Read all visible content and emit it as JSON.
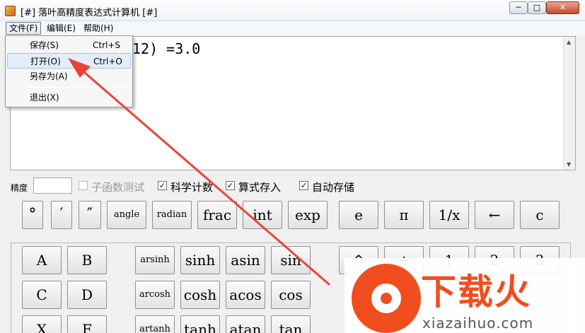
{
  "window": {
    "title": "[#] 落叶高精度表达式计算机 [#]",
    "min_glyph": "─",
    "max_glyph": "□",
    "close_glyph": "✕"
  },
  "menubar": {
    "file": "文件(F)",
    "edit": "编辑(E)",
    "help": "帮助(H)"
  },
  "file_menu": {
    "items": [
      {
        "label": "保存(S)",
        "shortcut": "Ctrl+S"
      },
      {
        "label": "打开(O)",
        "shortcut": "Ctrl+O"
      },
      {
        "label": "另存为(A)",
        "shortcut": ""
      },
      {
        "label": "退出(X)",
        "shortcut": ""
      }
    ],
    "highlighted_index": 1
  },
  "output": {
    "text": "12) =3.0"
  },
  "options": {
    "precision_label": "精度",
    "precision_value": "",
    "subfunc_test": {
      "label": "子函数测试",
      "checked": false,
      "enabled": false
    },
    "scientific": {
      "label": "科学计数",
      "checked": true
    },
    "save_expr": {
      "label": "算式存入",
      "checked": true
    },
    "auto_save": {
      "label": "自动存储",
      "checked": true
    },
    "check_glyph": "✓"
  },
  "top_buttons": [
    "°",
    "′",
    "″",
    "angle",
    "radian",
    "frac",
    "int",
    "exp",
    "e",
    "π",
    "1/x",
    "←",
    "c"
  ],
  "keypad": {
    "letters": [
      "A",
      "B",
      "C",
      "D",
      "X",
      "F"
    ],
    "hyper": [
      "arsinh",
      "sinh",
      "asin",
      "sin",
      "arcosh",
      "cosh",
      "acos",
      "cos",
      "artanh",
      "tanh",
      "atan",
      "tan"
    ],
    "right": [
      "^",
      "+",
      "1",
      "2",
      "3"
    ]
  },
  "watermark": {
    "brand": "下载火",
    "url": "xiazaihuo.com"
  }
}
